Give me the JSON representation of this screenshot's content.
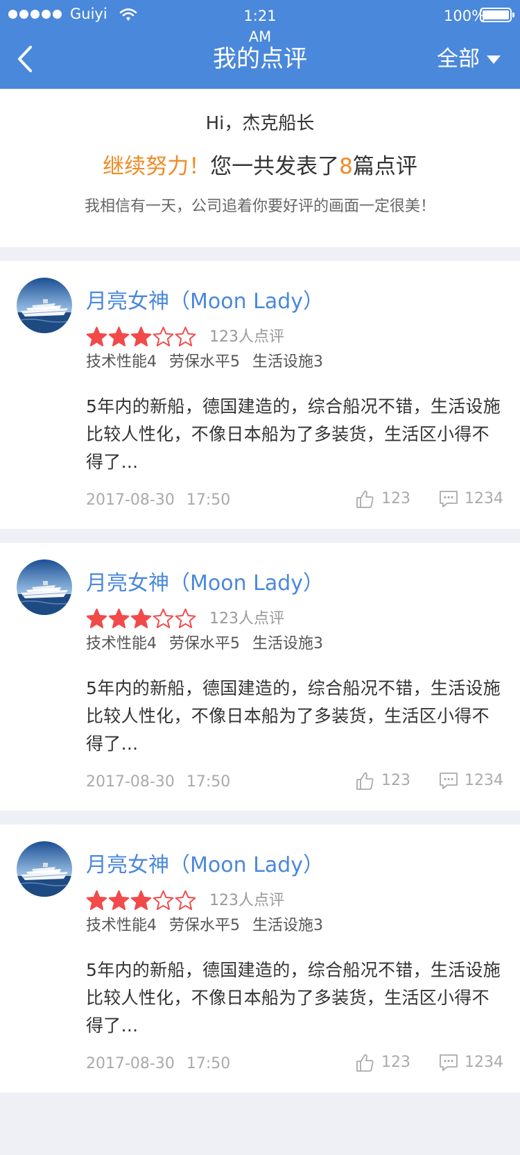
{
  "status_bar": {
    "carrier": "Guiyi",
    "time": "1:21 AM",
    "battery": "100%"
  },
  "nav": {
    "title": "我的点评",
    "filter_label": "全部"
  },
  "summary": {
    "greeting": "Hi，杰克船长",
    "encourage": "继续努力！",
    "count_prefix": "您一共发表了",
    "count": "8",
    "count_suffix": "篇点评",
    "motto": "我相信有一天，公司追着你要好评的画面一定很美！"
  },
  "colors": {
    "brand": "#4a88db",
    "highlight": "#f08a24",
    "star": "#f24a4a"
  },
  "reviews": [
    {
      "ship_name": "月亮女神（Moon Lady）",
      "rating": 3,
      "rating_max": 5,
      "review_count": "123人点评",
      "scores": [
        "技术性能4",
        "劳保水平5",
        "生活设施3"
      ],
      "text": "5年内的新船，德国建造的，综合船况不错，生活设施比较人性化，不像日本船为了多装货，生活区小得不得了...",
      "date": "2017-08-30 17:50",
      "likes": "123",
      "comments": "1234"
    },
    {
      "ship_name": "月亮女神（Moon Lady）",
      "rating": 3,
      "rating_max": 5,
      "review_count": "123人点评",
      "scores": [
        "技术性能4",
        "劳保水平5",
        "生活设施3"
      ],
      "text": "5年内的新船，德国建造的，综合船况不错，生活设施比较人性化，不像日本船为了多装货，生活区小得不得了...",
      "date": "2017-08-30 17:50",
      "likes": "123",
      "comments": "1234"
    },
    {
      "ship_name": "月亮女神（Moon Lady）",
      "rating": 3,
      "rating_max": 5,
      "review_count": "123人点评",
      "scores": [
        "技术性能4",
        "劳保水平5",
        "生活设施3"
      ],
      "text": "5年内的新船，德国建造的，综合船况不错，生活设施比较人性化，不像日本船为了多装货，生活区小得不得了...",
      "date": "2017-08-30 17:50",
      "likes": "123",
      "comments": "1234"
    }
  ]
}
